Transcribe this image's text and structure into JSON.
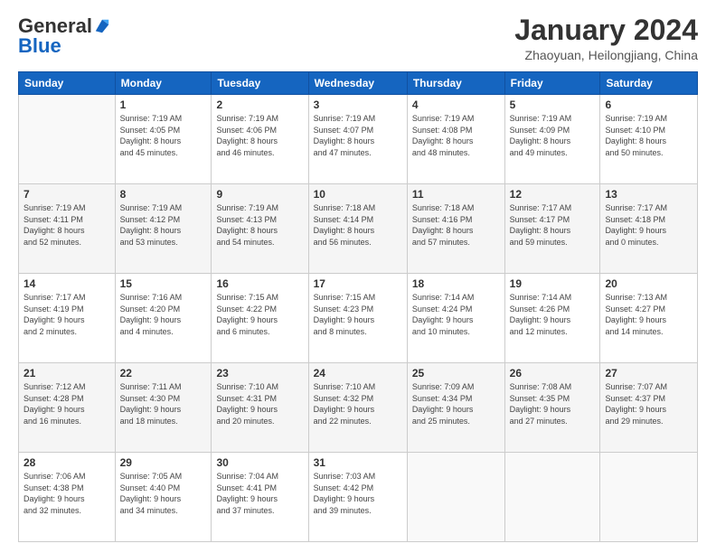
{
  "logo": {
    "general": "General",
    "blue": "Blue"
  },
  "header": {
    "title": "January 2024",
    "subtitle": "Zhaoyuan, Heilongjiang, China"
  },
  "columns": [
    "Sunday",
    "Monday",
    "Tuesday",
    "Wednesday",
    "Thursday",
    "Friday",
    "Saturday"
  ],
  "weeks": [
    [
      {
        "day": "",
        "info": ""
      },
      {
        "day": "1",
        "info": "Sunrise: 7:19 AM\nSunset: 4:05 PM\nDaylight: 8 hours\nand 45 minutes."
      },
      {
        "day": "2",
        "info": "Sunrise: 7:19 AM\nSunset: 4:06 PM\nDaylight: 8 hours\nand 46 minutes."
      },
      {
        "day": "3",
        "info": "Sunrise: 7:19 AM\nSunset: 4:07 PM\nDaylight: 8 hours\nand 47 minutes."
      },
      {
        "day": "4",
        "info": "Sunrise: 7:19 AM\nSunset: 4:08 PM\nDaylight: 8 hours\nand 48 minutes."
      },
      {
        "day": "5",
        "info": "Sunrise: 7:19 AM\nSunset: 4:09 PM\nDaylight: 8 hours\nand 49 minutes."
      },
      {
        "day": "6",
        "info": "Sunrise: 7:19 AM\nSunset: 4:10 PM\nDaylight: 8 hours\nand 50 minutes."
      }
    ],
    [
      {
        "day": "7",
        "info": "Sunrise: 7:19 AM\nSunset: 4:11 PM\nDaylight: 8 hours\nand 52 minutes."
      },
      {
        "day": "8",
        "info": "Sunrise: 7:19 AM\nSunset: 4:12 PM\nDaylight: 8 hours\nand 53 minutes."
      },
      {
        "day": "9",
        "info": "Sunrise: 7:19 AM\nSunset: 4:13 PM\nDaylight: 8 hours\nand 54 minutes."
      },
      {
        "day": "10",
        "info": "Sunrise: 7:18 AM\nSunset: 4:14 PM\nDaylight: 8 hours\nand 56 minutes."
      },
      {
        "day": "11",
        "info": "Sunrise: 7:18 AM\nSunset: 4:16 PM\nDaylight: 8 hours\nand 57 minutes."
      },
      {
        "day": "12",
        "info": "Sunrise: 7:17 AM\nSunset: 4:17 PM\nDaylight: 8 hours\nand 59 minutes."
      },
      {
        "day": "13",
        "info": "Sunrise: 7:17 AM\nSunset: 4:18 PM\nDaylight: 9 hours\nand 0 minutes."
      }
    ],
    [
      {
        "day": "14",
        "info": "Sunrise: 7:17 AM\nSunset: 4:19 PM\nDaylight: 9 hours\nand 2 minutes."
      },
      {
        "day": "15",
        "info": "Sunrise: 7:16 AM\nSunset: 4:20 PM\nDaylight: 9 hours\nand 4 minutes."
      },
      {
        "day": "16",
        "info": "Sunrise: 7:15 AM\nSunset: 4:22 PM\nDaylight: 9 hours\nand 6 minutes."
      },
      {
        "day": "17",
        "info": "Sunrise: 7:15 AM\nSunset: 4:23 PM\nDaylight: 9 hours\nand 8 minutes."
      },
      {
        "day": "18",
        "info": "Sunrise: 7:14 AM\nSunset: 4:24 PM\nDaylight: 9 hours\nand 10 minutes."
      },
      {
        "day": "19",
        "info": "Sunrise: 7:14 AM\nSunset: 4:26 PM\nDaylight: 9 hours\nand 12 minutes."
      },
      {
        "day": "20",
        "info": "Sunrise: 7:13 AM\nSunset: 4:27 PM\nDaylight: 9 hours\nand 14 minutes."
      }
    ],
    [
      {
        "day": "21",
        "info": "Sunrise: 7:12 AM\nSunset: 4:28 PM\nDaylight: 9 hours\nand 16 minutes."
      },
      {
        "day": "22",
        "info": "Sunrise: 7:11 AM\nSunset: 4:30 PM\nDaylight: 9 hours\nand 18 minutes."
      },
      {
        "day": "23",
        "info": "Sunrise: 7:10 AM\nSunset: 4:31 PM\nDaylight: 9 hours\nand 20 minutes."
      },
      {
        "day": "24",
        "info": "Sunrise: 7:10 AM\nSunset: 4:32 PM\nDaylight: 9 hours\nand 22 minutes."
      },
      {
        "day": "25",
        "info": "Sunrise: 7:09 AM\nSunset: 4:34 PM\nDaylight: 9 hours\nand 25 minutes."
      },
      {
        "day": "26",
        "info": "Sunrise: 7:08 AM\nSunset: 4:35 PM\nDaylight: 9 hours\nand 27 minutes."
      },
      {
        "day": "27",
        "info": "Sunrise: 7:07 AM\nSunset: 4:37 PM\nDaylight: 9 hours\nand 29 minutes."
      }
    ],
    [
      {
        "day": "28",
        "info": "Sunrise: 7:06 AM\nSunset: 4:38 PM\nDaylight: 9 hours\nand 32 minutes."
      },
      {
        "day": "29",
        "info": "Sunrise: 7:05 AM\nSunset: 4:40 PM\nDaylight: 9 hours\nand 34 minutes."
      },
      {
        "day": "30",
        "info": "Sunrise: 7:04 AM\nSunset: 4:41 PM\nDaylight: 9 hours\nand 37 minutes."
      },
      {
        "day": "31",
        "info": "Sunrise: 7:03 AM\nSunset: 4:42 PM\nDaylight: 9 hours\nand 39 minutes."
      },
      {
        "day": "",
        "info": ""
      },
      {
        "day": "",
        "info": ""
      },
      {
        "day": "",
        "info": ""
      }
    ]
  ]
}
